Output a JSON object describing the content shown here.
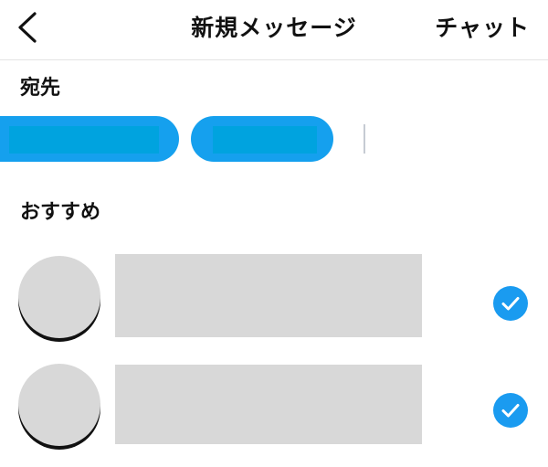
{
  "header": {
    "title": "新規メッセージ",
    "chat_label": "チャット",
    "back_icon": "chevron-left-icon"
  },
  "recipients": {
    "label": "宛先",
    "chips": [
      {
        "state": "selected-redacted"
      },
      {
        "state": "selected-redacted"
      }
    ]
  },
  "suggestions": {
    "label": "おすすめ",
    "items": [
      {
        "selected": true,
        "check_icon": "check-circle-icon"
      },
      {
        "selected": true,
        "check_icon": "check-circle-icon"
      }
    ]
  },
  "colors": {
    "accent": "#1a9bf0",
    "chip": "#15a0ee",
    "placeholder_gray": "#d8d8d8",
    "divider": "#e4e4e4"
  }
}
